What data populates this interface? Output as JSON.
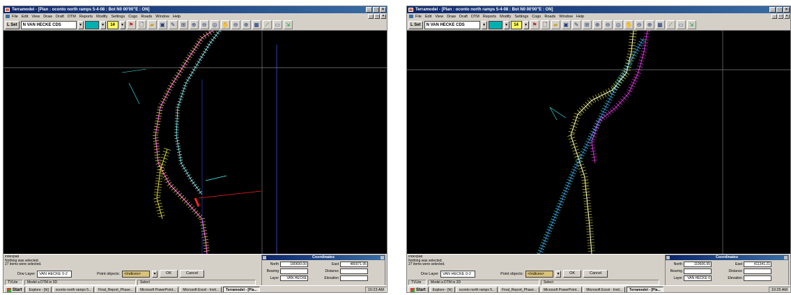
{
  "colors": {
    "titlebar": "#0a246a",
    "viewport_bg": "#000000",
    "crosshair": "#808080",
    "road_yellow": "#ffff40",
    "road_magenta": "#ff40ff",
    "road_cyan": "#40ffff",
    "road_white": "#ffffff",
    "road_blue": "#4060ff",
    "road_red": "#ff2020",
    "layer_color": "#00b0b0",
    "point_objects": "#d9c27a"
  },
  "left": {
    "window_title": "Terramodel - [Plan : oconto north ramps 5-4-08 : Bot N0 00'00\"E : ON]",
    "menu": [
      "File",
      "Edit",
      "View",
      "Draw",
      "Draft",
      "DTM",
      "Reports",
      "Modify",
      "Settings",
      "Cogo",
      "Roads",
      "Window",
      "Help"
    ],
    "toolbar": {
      "lset": "L Set",
      "layer": "N VAN HECKE CDS",
      "line_width": "14"
    },
    "command_log": [
      "indexpad",
      "Nothing was selected.",
      "27 items were selected."
    ],
    "draw_layer_label": "Drw Layer",
    "draw_layer_value": "VAN HECKE 0-2",
    "point_objects_label": "Point objects:",
    "point_objects_value": "<Indices>",
    "ok": "OK",
    "cancel": "Cancel",
    "status": [
      "TVLite",
      "Model a DTM in 3D",
      "Select"
    ],
    "coordinates": {
      "title": "Coordinates",
      "north_label": "North",
      "north_value": "180600.00",
      "east_label": "East",
      "east_value": "480071.95",
      "bearing_label": "Bearing",
      "bearing_value": "",
      "distance_label": "Distance",
      "distance_value": "",
      "layer_label": "Layer",
      "layer_value": "VAN HECKE",
      "elevation_label": "Elevation",
      "elevation_value": ""
    },
    "taskbar": {
      "start": "Start",
      "tasks": [
        "Explore - [hi]",
        "oconto north ramps 5...",
        "Final_Report_Phase...",
        "Microsoft PowerPoint...",
        "Microsoft Excel - Invit...",
        "Terramodel - [Pla..."
      ],
      "clock": "10:23 AM"
    }
  },
  "right": {
    "window_title": "Terramodel - [Plan : oconto north ramps 5-4-08 : Bot N0 00'00\"E : ON]",
    "menu": [
      "File",
      "Edit",
      "View",
      "Draw",
      "Draft",
      "DTM",
      "Reports",
      "Modify",
      "Settings",
      "Cogo",
      "Roads",
      "Window",
      "Help"
    ],
    "toolbar": {
      "lset": "L Set",
      "layer": "N VAN HECKE CDS",
      "line_width": "14"
    },
    "command_log": [
      "indexpad",
      "Nothing was selected.",
      "27 items were selected."
    ],
    "draw_layer_label": "Drw Layer",
    "draw_layer_value": "VAN HECKE 0-2",
    "point_objects_label": "Point objects:",
    "point_objects_value": "<Indices>",
    "ok": "OK",
    "cancel": "Cancel",
    "status": [
      "TVLite",
      "Model a DTM in 3D",
      "Select"
    ],
    "coordinates": {
      "title": "Coordinates",
      "north_label": "North",
      "north_value": "119606.95",
      "east_label": "East",
      "east_value": "411341.21",
      "bearing_label": "Bearing",
      "bearing_value": "",
      "distance_label": "Distance",
      "distance_value": "",
      "layer_label": "Layer",
      "layer_value": "VAN HECKE 0",
      "elevation_label": "Elevation",
      "elevation_value": ""
    },
    "taskbar": {
      "start": "Start",
      "tasks": [
        "Explore - [hi]",
        "oconto north ramps 5...",
        "Final_Report_Phase...",
        "Microsoft PowerPoint...",
        "Microsoft Excel - Invit...",
        "Terramodel - [Pla..."
      ],
      "clock": "10:25 AM"
    }
  }
}
